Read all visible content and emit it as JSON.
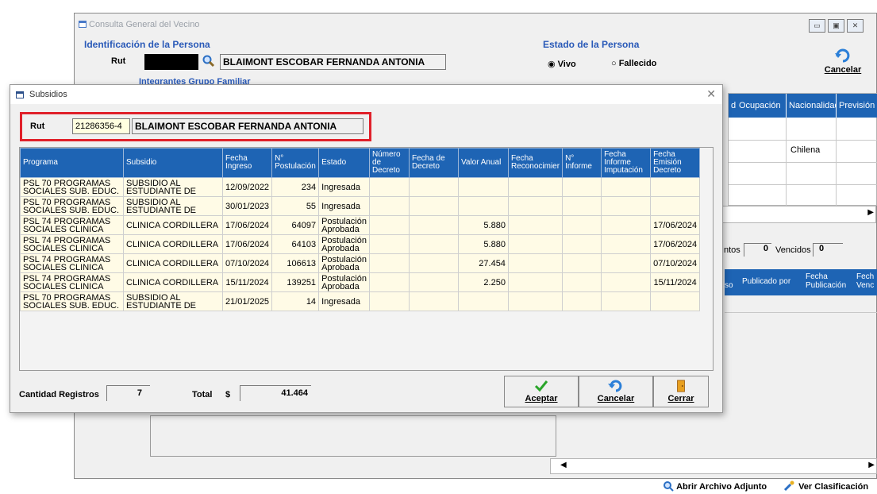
{
  "bg": {
    "title": "Consulta General del Vecino",
    "identificacion_caption": "Identificación de la Persona",
    "rut_label": "Rut",
    "person_name": "BLAIMONT ESCOBAR FERNANDA ANTONIA",
    "estado_caption": "Estado de la Persona",
    "estado_options": [
      "Vivo",
      "Fallecido"
    ],
    "estado_selected": "Vivo",
    "cancel_label": "Cancelar",
    "grupo_caption": "Integrantes Grupo Familiar",
    "grid_headers": [
      "d",
      "Ocupación",
      "Nacionalidad",
      "Previsión"
    ],
    "nationality_value": "Chilena",
    "vigentes_label": "ntos",
    "vigentes_value": "0",
    "vencidos_label": "Vencidos",
    "vencidos_value": "0",
    "doc_headers": [
      "so",
      "Publicado por",
      "Fecha Publicación",
      "Fech Venc"
    ],
    "abrir_adjunto": "Abrir Archivo Adjunto",
    "ver_clasificacion": "Ver Clasificación"
  },
  "dialog": {
    "title": "Subsidios",
    "rut_label": "Rut",
    "rut_value": "21286356-4",
    "name_value": "BLAIMONT ESCOBAR FERNANDA ANTONIA",
    "columns": [
      "Programa",
      "Subsidio",
      "Fecha Ingreso",
      "N° Postulación",
      "Estado",
      "Número de Decreto",
      "Fecha de Decreto",
      "Valor Anual",
      "Fecha Reconocimier",
      "N° Informe",
      "Fecha Informe Imputación",
      "Fecha Emisión Decreto"
    ],
    "rows": [
      [
        "PSL 70 PROGRAMAS SOCIALES SUB. EDUC.",
        "SUBSIDIO AL ESTUDIANTE DE",
        "12/09/2022",
        "234",
        "Ingresada",
        "",
        "",
        "",
        "",
        "",
        "",
        ""
      ],
      [
        "PSL 70 PROGRAMAS SOCIALES SUB. EDUC.",
        "SUBSIDIO AL ESTUDIANTE DE",
        "30/01/2023",
        "55",
        "Ingresada",
        "",
        "",
        "",
        "",
        "",
        "",
        ""
      ],
      [
        "PSL 74 PROGRAMAS SOCIALES CLINICA",
        "CLINICA CORDILLERA",
        "17/06/2024",
        "64097",
        "Postulación Aprobada",
        "",
        "",
        "5.880",
        "",
        "",
        "",
        "17/06/2024"
      ],
      [
        "PSL 74 PROGRAMAS SOCIALES CLINICA",
        "CLINICA CORDILLERA",
        "17/06/2024",
        "64103",
        "Postulación Aprobada",
        "",
        "",
        "5.880",
        "",
        "",
        "",
        "17/06/2024"
      ],
      [
        "PSL 74 PROGRAMAS SOCIALES CLINICA",
        "CLINICA CORDILLERA",
        "07/10/2024",
        "106613",
        "Postulación Aprobada",
        "",
        "",
        "27.454",
        "",
        "",
        "",
        "07/10/2024"
      ],
      [
        "PSL 74 PROGRAMAS SOCIALES CLINICA",
        "CLINICA CORDILLERA",
        "15/11/2024",
        "139251",
        "Postulación Aprobada",
        "",
        "",
        "2.250",
        "",
        "",
        "",
        "15/11/2024"
      ],
      [
        "PSL 70 PROGRAMAS SOCIALES SUB. EDUC.",
        "SUBSIDIO AL ESTUDIANTE DE",
        "21/01/2025",
        "14",
        "Ingresada",
        "",
        "",
        "",
        "",
        "",
        "",
        ""
      ]
    ],
    "cantidad_label": "Cantidad Registros",
    "cantidad_value": "7",
    "total_label": "Total",
    "currency_symbol": "$",
    "total_value": "41.464",
    "buttons": {
      "aceptar": "Aceptar",
      "cancelar": "Cancelar",
      "cerrar": "Cerrar"
    }
  },
  "colors": {
    "header_blue": "#1e64b4",
    "row_yellow": "#fffbe6",
    "highlight_red": "#e0202a",
    "caption_blue": "#2a5ab8"
  }
}
